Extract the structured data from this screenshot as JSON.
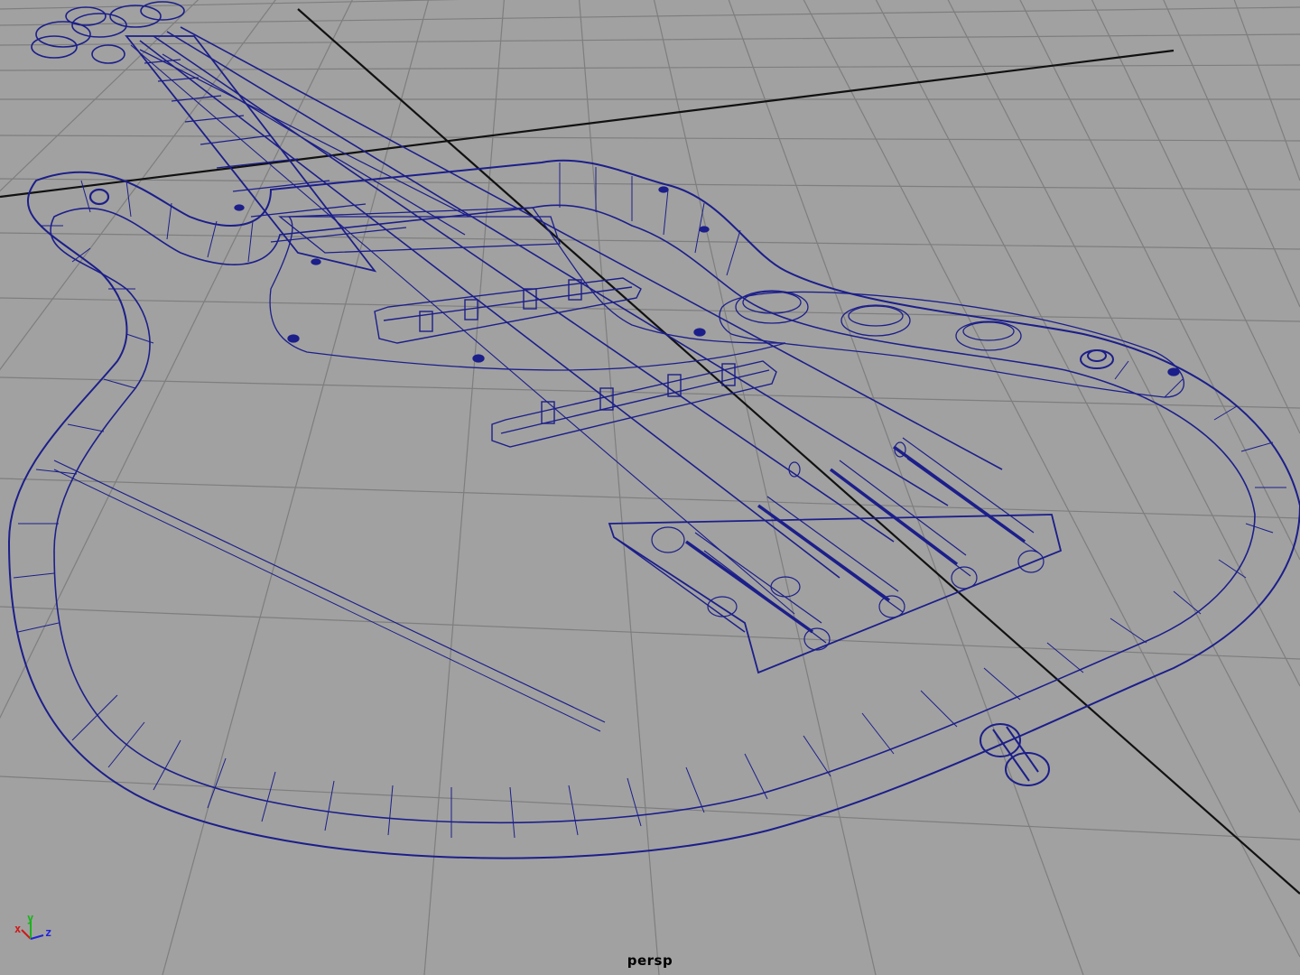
{
  "viewport": {
    "camera_name": "persp",
    "background_color": "#a1a1a1",
    "grid_color": "#7e7e7e",
    "axis_line_color": "#111111",
    "wireframe_color": "#1c1e8a",
    "model": "bass-guitar-wireframe"
  },
  "axis_gizmo": {
    "x_label": "x",
    "y_label": "y",
    "z_label": "z",
    "x_color": "#d01818",
    "y_color": "#19b319",
    "z_color": "#2222d8"
  }
}
